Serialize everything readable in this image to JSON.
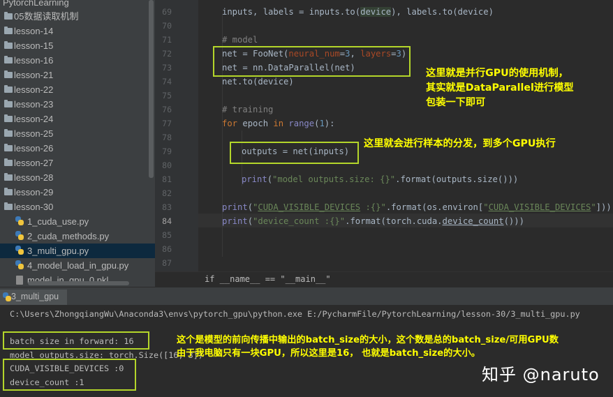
{
  "project_tree": {
    "items": [
      {
        "label": "PytorchLearning",
        "type": "folder"
      },
      {
        "label": "05数据读取机制",
        "type": "folder"
      },
      {
        "label": "lesson-14",
        "type": "folder"
      },
      {
        "label": "lesson-15",
        "type": "folder"
      },
      {
        "label": "lesson-16",
        "type": "folder"
      },
      {
        "label": "lesson-21",
        "type": "folder"
      },
      {
        "label": "lesson-22",
        "type": "folder"
      },
      {
        "label": "lesson-23",
        "type": "folder"
      },
      {
        "label": "lesson-24",
        "type": "folder"
      },
      {
        "label": "lesson-25",
        "type": "folder"
      },
      {
        "label": "lesson-26",
        "type": "folder"
      },
      {
        "label": "lesson-27",
        "type": "folder"
      },
      {
        "label": "lesson-28",
        "type": "folder"
      },
      {
        "label": "lesson-29",
        "type": "folder"
      },
      {
        "label": "lesson-30",
        "type": "folder"
      },
      {
        "label": "1_cuda_use.py",
        "type": "python-file"
      },
      {
        "label": "2_cuda_methods.py",
        "type": "python-file"
      },
      {
        "label": "3_multi_gpu.py",
        "type": "python-file",
        "selected": true
      },
      {
        "label": "4_model_load_in_gpu.py",
        "type": "python-file"
      },
      {
        "label": "model_in_gpu_0.pkl",
        "type": "file"
      }
    ]
  },
  "editor": {
    "line_numbers": [
      "69",
      "70",
      "71",
      "72",
      "73",
      "74",
      "75",
      "76",
      "77",
      "78",
      "79",
      "80",
      "81",
      "82",
      "83",
      "84",
      "85",
      "86",
      "87"
    ],
    "current_line": "84",
    "lines": {
      "l69": {
        "a": "inputs, labels = inputs.to(",
        "b": "device",
        "c": "), labels.to(device)"
      },
      "l71": "# model",
      "l72": {
        "a": "net = FooNet(",
        "b": "neural_num",
        "c": "=",
        "d": "3",
        "e": ", ",
        "f": "layers",
        "g": "=",
        "h": "3",
        "i": ")"
      },
      "l73": "net = nn.DataParallel(net)",
      "l74": "net.to(device)",
      "l76": "# training",
      "l77": {
        "a": "for",
        "b": " epoch ",
        "c": "in",
        "d": " ",
        "e": "range",
        "f": "(",
        "g": "1",
        "h": "):"
      },
      "l79": "outputs = net(inputs)",
      "l81": {
        "a": "print",
        "b": "(",
        "c": "\"model outputs.size: {}\"",
        "d": ".format(outputs.size()))"
      },
      "l83": {
        "a": "print",
        "b": "(",
        "c": "\"",
        "d": "CUDA_VISIBLE_DEVICES",
        "e": " :{}\"",
        "f": ".format(os.environ[",
        "g": "\"",
        "h": "CUDA_VISIBLE_DEVICES",
        "i": "\"",
        "j": "]))"
      },
      "l84": {
        "a": "print",
        "b": "(",
        "c": "\"device_count :{}\"",
        "d": ".format(torch.cuda.",
        "e": "device_count",
        "f": "()))"
      }
    },
    "breadcrumb": "if __name__ == \"__main__\""
  },
  "run_panel": {
    "tab_label": "3_multi_gpu",
    "console_lines": [
      "C:\\Users\\ZhongqiangWu\\Anaconda3\\envs\\pytorch_gpu\\python.exe E:/PycharmFile/PytorchLearning/lesson-30/3_multi_gpu.py",
      "",
      "batch size in forward: 16",
      "model outputs.size: torch.Size([16, 3])",
      "CUDA_VISIBLE_DEVICES :0",
      "device_count :1"
    ]
  },
  "annotations": {
    "note1": [
      "这里就是并行GPU的使用机制，",
      "其实就是DataParallel进行模型",
      "包装一下即可"
    ],
    "note2": "这里就会进行样本的分发，到多个GPU执行",
    "note3": [
      "这个是模型的前向传播中输出的batch_size的大小，这个数是总的batch_size/可用GPU数",
      "由于我电脑只有一块GPU，所以这里是16，  也就是batch_size的大小。"
    ]
  },
  "watermark": "知乎 @naruto",
  "colors": {
    "annotation_box": "#b4d62a",
    "annotation_text": "#ffff00",
    "keyword": "#cc7832",
    "string": "#6a8759",
    "number": "#6897bb",
    "comment": "#808080",
    "param": "#aa4926"
  }
}
